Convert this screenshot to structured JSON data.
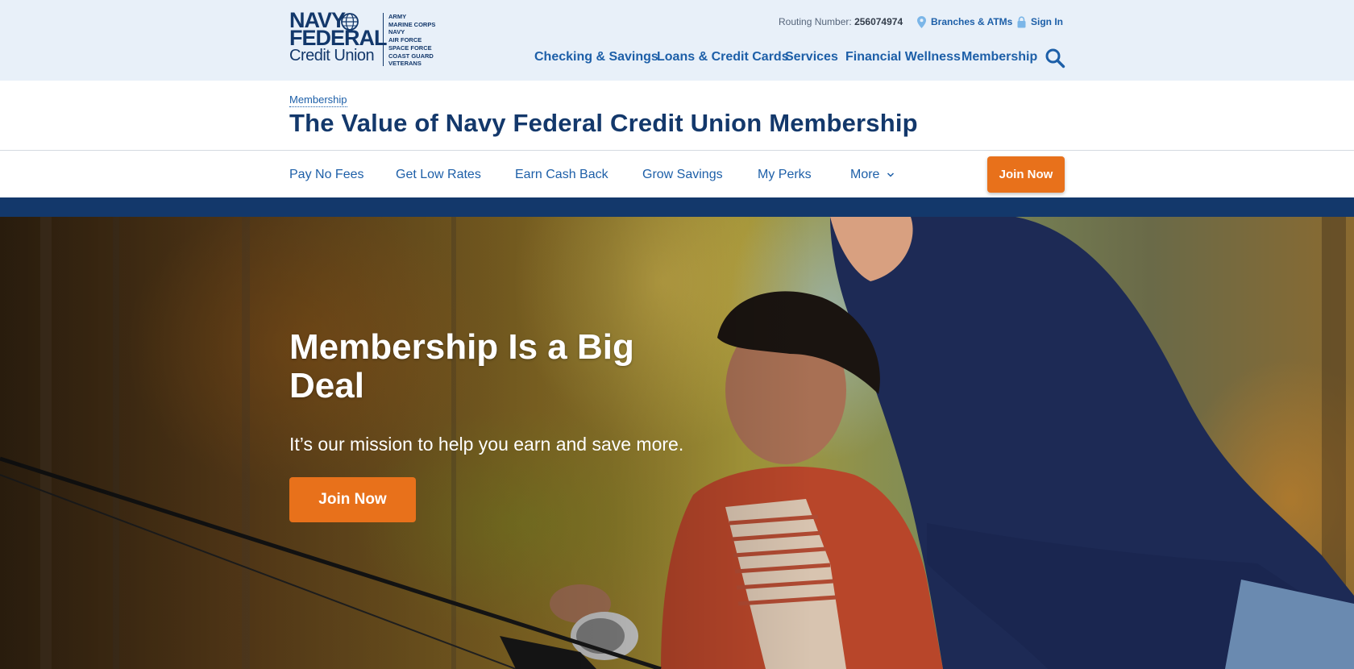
{
  "header": {
    "logo": {
      "line1": "NAVY",
      "line2": "FEDERAL",
      "line3": "Credit Union",
      "branches": [
        "ARMY",
        "MARINE CORPS",
        "NAVY",
        "AIR FORCE",
        "SPACE FORCE",
        "COAST GUARD",
        "VETERANS"
      ]
    },
    "routing_label": "Routing Number:",
    "routing_number": "256074974",
    "branches_link": "Branches & ATMs",
    "signin_link": "Sign In",
    "nav": [
      "Checking & Savings",
      "Loans & Credit Cards",
      "Services",
      "Financial Wellness",
      "Membership"
    ],
    "search_icon": "search-icon"
  },
  "title_band": {
    "breadcrumb": "Membership",
    "title": "The Value of Navy Federal Credit Union Membership"
  },
  "sub_nav": {
    "items": [
      "Pay No Fees",
      "Get Low Rates",
      "Earn Cash Back",
      "Grow Savings",
      "My Perks",
      "More"
    ],
    "join_label": "Join Now"
  },
  "hero": {
    "title": "Membership Is a Big Deal",
    "subtitle": "It’s our mission to help you earn and save more.",
    "cta": "Join Now"
  },
  "colors": {
    "navy": "#13386b",
    "link_blue": "#1d5fa8",
    "header_bg": "#e8f0f9",
    "cta_orange": "#e8711b"
  }
}
